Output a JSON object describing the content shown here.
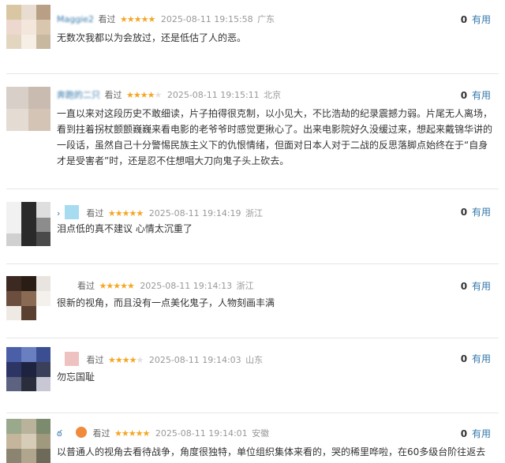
{
  "comments": [
    {
      "username": "Maggie2",
      "seen_label": "看过",
      "stars": "★★★★★",
      "stars_off": "",
      "time": "2025-08-11 19:15:58",
      "location": "广东",
      "useful_count": "0",
      "useful_label": "有用",
      "text": "无数次我都以为会放过，还是低估了人的恶。"
    },
    {
      "username": "奔跑的二只",
      "seen_label": "看过",
      "stars": "★★★★",
      "stars_off": "★",
      "time": "2025-08-11 19:15:11",
      "location": "北京",
      "useful_count": "0",
      "useful_label": "有用",
      "text": "一直以来对这段历史不敢细读，片子拍得很克制，以小见大，不比浩劫的纪录震撼力弱。片尾无人离场，看到拄着拐杖颤颤巍巍来看电影的老爷爷时感觉更揪心了。出来电影院好久没缓过来，想起来戴锦华讲的一段话，虽然自己十分警惕民族主义下的仇恨情绪，但面对日本人对于二战的反思落脚点始终在于“自身才是受害者”时，还是忍不住想唱大刀向鬼子头上砍去。"
    },
    {
      "username": "›",
      "seen_label": "看过",
      "stars": "★★★★★",
      "stars_off": "",
      "time": "2025-08-11 19:14:19",
      "location": "浙江",
      "useful_count": "0",
      "useful_label": "有用",
      "text": "泪点低的真不建议 心情太沉重了"
    },
    {
      "username": "",
      "seen_label": "看过",
      "stars": "★★★★★",
      "stars_off": "",
      "time": "2025-08-11 19:14:13",
      "location": "浙江",
      "useful_count": "0",
      "useful_label": "有用",
      "text": "很新的视角，而且没有一点美化鬼子，人物刻画丰满"
    },
    {
      "username": "",
      "seen_label": "看过",
      "stars": "★★★★",
      "stars_off": "★",
      "time": "2025-08-11 19:14:03",
      "location": "山东",
      "useful_count": "0",
      "useful_label": "有用",
      "text": "勿忘国耻"
    },
    {
      "username": "ఠ",
      "seen_label": "看过",
      "stars": "★★★★★",
      "stars_off": "",
      "time": "2025-08-11 19:14:01",
      "location": "安徽",
      "useful_count": "0",
      "useful_label": "有用",
      "text": "以普通人的视角去看待战争，角度很独特，单位组织集体来看的，哭的稀里哗啦，在60多级台阶往返去"
    }
  ],
  "colors": {
    "star": "#f5a623",
    "link": "#3377aa",
    "meta": "#999999"
  }
}
